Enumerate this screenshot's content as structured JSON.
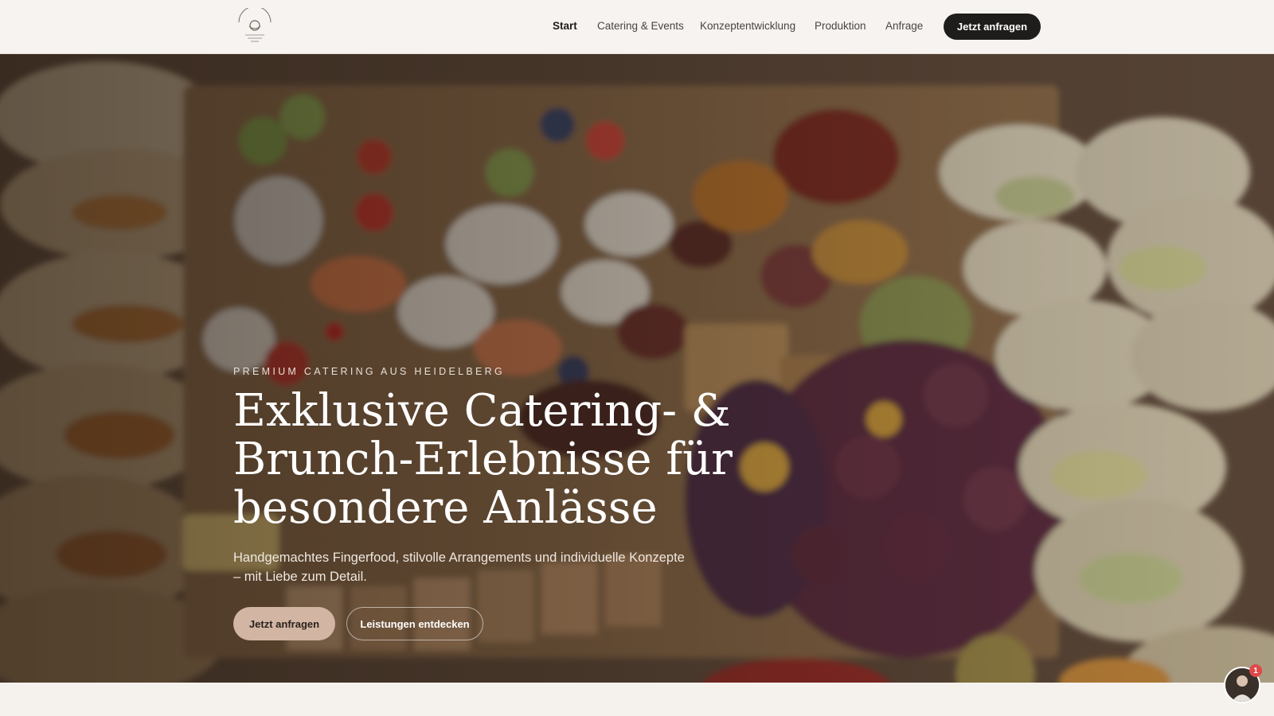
{
  "brand": {
    "logo_name": "circular catering logo"
  },
  "nav": {
    "items": [
      {
        "label": "Start",
        "active": true
      },
      {
        "label": "Catering & Events",
        "active": false
      },
      {
        "label": "Konzeptentwicklung",
        "active": false
      },
      {
        "label": "Produktion",
        "active": false
      },
      {
        "label": "Anfrage",
        "active": false
      }
    ],
    "cta_label": "Jetzt anfragen"
  },
  "hero": {
    "eyebrow": "PREMIUM CATERING AUS HEIDELBERG",
    "headline": "Exklusive Catering- & Brunch-Erlebnisse für besondere Anlässe",
    "subline": "Handgemachtes Fingerfood, stilvolle Arrangements und individuelle Konzepte – mit Liebe zum Detail.",
    "primary_button": "Jetzt anfragen",
    "secondary_button": "Leistungen entdecken"
  },
  "chat": {
    "badge_count": "1"
  },
  "colors": {
    "header_bg": "#f6f3f0",
    "dark_button": "#1f1d1c",
    "accent_button": "#d2b6a3",
    "hero_text": "#ffffff"
  }
}
